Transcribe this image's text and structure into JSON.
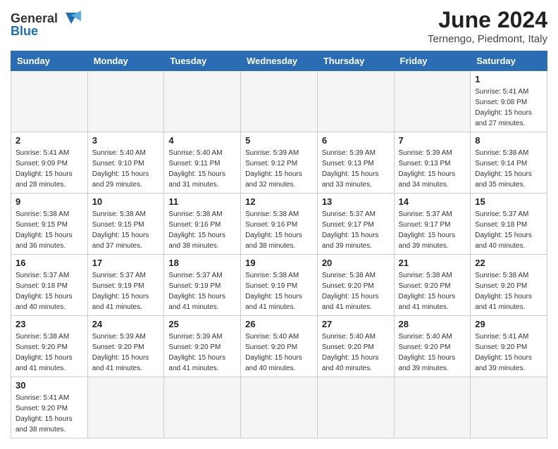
{
  "header": {
    "logo_general": "General",
    "logo_blue": "Blue",
    "title": "June 2024",
    "subtitle": "Ternengo, Piedmont, Italy"
  },
  "weekdays": [
    "Sunday",
    "Monday",
    "Tuesday",
    "Wednesday",
    "Thursday",
    "Friday",
    "Saturday"
  ],
  "weeks": [
    [
      {
        "day": "",
        "info": ""
      },
      {
        "day": "",
        "info": ""
      },
      {
        "day": "",
        "info": ""
      },
      {
        "day": "",
        "info": ""
      },
      {
        "day": "",
        "info": ""
      },
      {
        "day": "",
        "info": ""
      },
      {
        "day": "1",
        "info": "Sunrise: 5:41 AM\nSunset: 9:08 PM\nDaylight: 15 hours and 27 minutes."
      }
    ],
    [
      {
        "day": "2",
        "info": "Sunrise: 5:41 AM\nSunset: 9:09 PM\nDaylight: 15 hours and 28 minutes."
      },
      {
        "day": "3",
        "info": "Sunrise: 5:40 AM\nSunset: 9:10 PM\nDaylight: 15 hours and 29 minutes."
      },
      {
        "day": "4",
        "info": "Sunrise: 5:40 AM\nSunset: 9:11 PM\nDaylight: 15 hours and 31 minutes."
      },
      {
        "day": "5",
        "info": "Sunrise: 5:39 AM\nSunset: 9:12 PM\nDaylight: 15 hours and 32 minutes."
      },
      {
        "day": "6",
        "info": "Sunrise: 5:39 AM\nSunset: 9:13 PM\nDaylight: 15 hours and 33 minutes."
      },
      {
        "day": "7",
        "info": "Sunrise: 5:39 AM\nSunset: 9:13 PM\nDaylight: 15 hours and 34 minutes."
      },
      {
        "day": "8",
        "info": "Sunrise: 5:38 AM\nSunset: 9:14 PM\nDaylight: 15 hours and 35 minutes."
      }
    ],
    [
      {
        "day": "9",
        "info": "Sunrise: 5:38 AM\nSunset: 9:15 PM\nDaylight: 15 hours and 36 minutes."
      },
      {
        "day": "10",
        "info": "Sunrise: 5:38 AM\nSunset: 9:15 PM\nDaylight: 15 hours and 37 minutes."
      },
      {
        "day": "11",
        "info": "Sunrise: 5:38 AM\nSunset: 9:16 PM\nDaylight: 15 hours and 38 minutes."
      },
      {
        "day": "12",
        "info": "Sunrise: 5:38 AM\nSunset: 9:16 PM\nDaylight: 15 hours and 38 minutes."
      },
      {
        "day": "13",
        "info": "Sunrise: 5:37 AM\nSunset: 9:17 PM\nDaylight: 15 hours and 39 minutes."
      },
      {
        "day": "14",
        "info": "Sunrise: 5:37 AM\nSunset: 9:17 PM\nDaylight: 15 hours and 39 minutes."
      },
      {
        "day": "15",
        "info": "Sunrise: 5:37 AM\nSunset: 9:18 PM\nDaylight: 15 hours and 40 minutes."
      }
    ],
    [
      {
        "day": "16",
        "info": "Sunrise: 5:37 AM\nSunset: 9:18 PM\nDaylight: 15 hours and 40 minutes."
      },
      {
        "day": "17",
        "info": "Sunrise: 5:37 AM\nSunset: 9:19 PM\nDaylight: 15 hours and 41 minutes."
      },
      {
        "day": "18",
        "info": "Sunrise: 5:37 AM\nSunset: 9:19 PM\nDaylight: 15 hours and 41 minutes."
      },
      {
        "day": "19",
        "info": "Sunrise: 5:38 AM\nSunset: 9:19 PM\nDaylight: 15 hours and 41 minutes."
      },
      {
        "day": "20",
        "info": "Sunrise: 5:38 AM\nSunset: 9:20 PM\nDaylight: 15 hours and 41 minutes."
      },
      {
        "day": "21",
        "info": "Sunrise: 5:38 AM\nSunset: 9:20 PM\nDaylight: 15 hours and 41 minutes."
      },
      {
        "day": "22",
        "info": "Sunrise: 5:38 AM\nSunset: 9:20 PM\nDaylight: 15 hours and 41 minutes."
      }
    ],
    [
      {
        "day": "23",
        "info": "Sunrise: 5:38 AM\nSunset: 9:20 PM\nDaylight: 15 hours and 41 minutes."
      },
      {
        "day": "24",
        "info": "Sunrise: 5:39 AM\nSunset: 9:20 PM\nDaylight: 15 hours and 41 minutes."
      },
      {
        "day": "25",
        "info": "Sunrise: 5:39 AM\nSunset: 9:20 PM\nDaylight: 15 hours and 41 minutes."
      },
      {
        "day": "26",
        "info": "Sunrise: 5:40 AM\nSunset: 9:20 PM\nDaylight: 15 hours and 40 minutes."
      },
      {
        "day": "27",
        "info": "Sunrise: 5:40 AM\nSunset: 9:20 PM\nDaylight: 15 hours and 40 minutes."
      },
      {
        "day": "28",
        "info": "Sunrise: 5:40 AM\nSunset: 9:20 PM\nDaylight: 15 hours and 39 minutes."
      },
      {
        "day": "29",
        "info": "Sunrise: 5:41 AM\nSunset: 9:20 PM\nDaylight: 15 hours and 39 minutes."
      }
    ],
    [
      {
        "day": "30",
        "info": "Sunrise: 5:41 AM\nSunset: 9:20 PM\nDaylight: 15 hours and 38 minutes."
      },
      {
        "day": "",
        "info": ""
      },
      {
        "day": "",
        "info": ""
      },
      {
        "day": "",
        "info": ""
      },
      {
        "day": "",
        "info": ""
      },
      {
        "day": "",
        "info": ""
      },
      {
        "day": "",
        "info": ""
      }
    ]
  ]
}
